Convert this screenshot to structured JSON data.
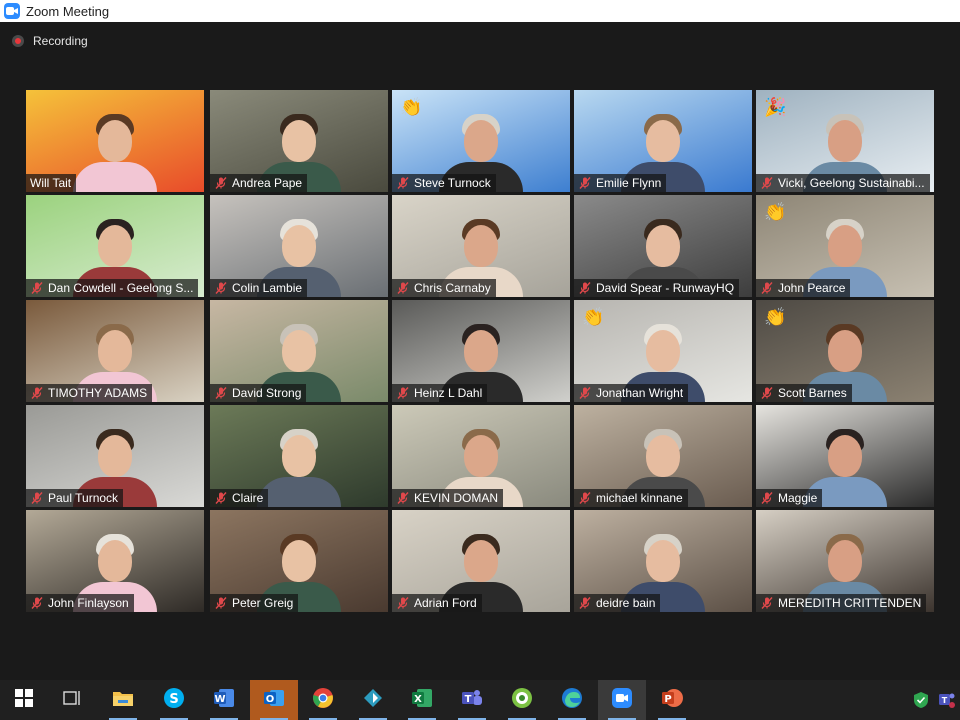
{
  "window": {
    "title": "Zoom Meeting",
    "app_icon": "zoom-camera-icon"
  },
  "recording": {
    "label": "Recording",
    "indicator_color": "#e8363b"
  },
  "active_speaker_border": "#e7e02a",
  "participants": [
    {
      "name": "Will Tait",
      "muted": false,
      "active": true
    },
    {
      "name": "Andrea Pape",
      "muted": true
    },
    {
      "name": "Steve Turnock",
      "muted": true,
      "reaction": "👏"
    },
    {
      "name": "Emilie Flynn",
      "muted": true
    },
    {
      "name": "Vicki, Geelong Sustainabi...",
      "muted": true,
      "reaction": "🎉"
    },
    {
      "name": "Dan Cowdell - Geelong S...",
      "muted": true
    },
    {
      "name": "Colin Lambie",
      "muted": true
    },
    {
      "name": "Chris Carnaby",
      "muted": true
    },
    {
      "name": "David Spear - RunwayHQ",
      "muted": true
    },
    {
      "name": "John Pearce",
      "muted": true,
      "reaction": "👏"
    },
    {
      "name": "TIMOTHY ADAMS",
      "muted": true
    },
    {
      "name": "David Strong",
      "muted": true
    },
    {
      "name": "Heinz L Dahl",
      "muted": true
    },
    {
      "name": "Jonathan Wright",
      "muted": true,
      "reaction": "👏"
    },
    {
      "name": "Scott Barnes",
      "muted": true,
      "reaction": "👏"
    },
    {
      "name": "Paul Turnock",
      "muted": true
    },
    {
      "name": "Claire",
      "muted": true
    },
    {
      "name": "KEVIN DOMAN",
      "muted": true
    },
    {
      "name": "michael kinnane",
      "muted": true
    },
    {
      "name": "Maggie",
      "muted": true
    },
    {
      "name": "John Finlayson",
      "muted": true
    },
    {
      "name": "Peter Greig",
      "muted": true
    },
    {
      "name": "Adrian Ford",
      "muted": true
    },
    {
      "name": "deidre bain",
      "muted": true
    },
    {
      "name": "MEREDITH CRITTENDEN",
      "muted": true
    }
  ],
  "taskbar": {
    "items": [
      {
        "icon": "windows-start-icon"
      },
      {
        "icon": "task-view-icon"
      },
      {
        "icon": "file-explorer-icon",
        "open": true
      },
      {
        "icon": "skype-icon",
        "open": true
      },
      {
        "icon": "word-icon",
        "open": true
      },
      {
        "icon": "outlook-icon",
        "open": true,
        "highlight": true
      },
      {
        "icon": "chrome-icon",
        "open": true
      },
      {
        "icon": "filmora-icon",
        "open": true
      },
      {
        "icon": "excel-icon",
        "open": true
      },
      {
        "icon": "teams-icon",
        "open": true
      },
      {
        "icon": "greenshot-icon",
        "open": true
      },
      {
        "icon": "edge-icon",
        "open": true
      },
      {
        "icon": "zoom-icon",
        "open": true,
        "active": true
      },
      {
        "icon": "powerpoint-icon",
        "open": true
      }
    ],
    "tray": [
      {
        "icon": "security-shield-icon"
      },
      {
        "icon": "teams-tray-icon"
      }
    ]
  }
}
